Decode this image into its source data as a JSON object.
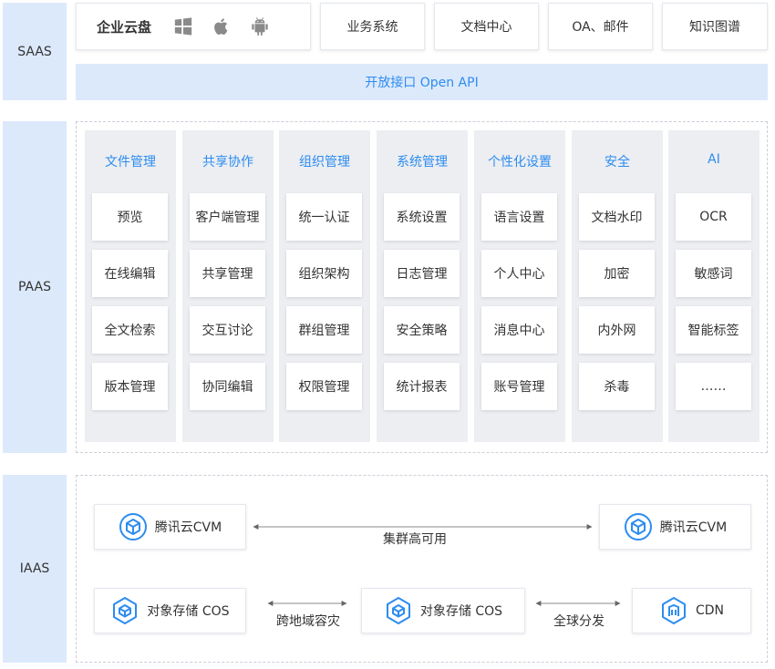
{
  "colors": {
    "accent": "#2d8cf0",
    "layer_bg": "#dce9fb",
    "column_bg": "#eceef2"
  },
  "layers": {
    "saas": "SAAS",
    "paas": "PAAS",
    "iaas": "IAAS"
  },
  "saas": {
    "cloud_disk": "企业云盘",
    "platform_icons": [
      "windows-icon",
      "apple-icon",
      "android-icon"
    ],
    "business_system": "业务系统",
    "doc_center": "文档中心",
    "oa_mail": "OA、邮件",
    "knowledge_graph": "知识图谱",
    "open_api": "开放接口 Open API"
  },
  "paas": {
    "columns": [
      {
        "title": "文件管理",
        "items": [
          "预览",
          "在线编辑",
          "全文检索",
          "版本管理"
        ]
      },
      {
        "title": "共享协作",
        "items": [
          "客户端管理",
          "共享管理",
          "交互讨论",
          "协同编辑"
        ]
      },
      {
        "title": "组织管理",
        "items": [
          "统一认证",
          "组织架构",
          "群组管理",
          "权限管理"
        ]
      },
      {
        "title": "系统管理",
        "items": [
          "系统设置",
          "日志管理",
          "安全策略",
          "统计报表"
        ]
      },
      {
        "title": "个性化设置",
        "items": [
          "语言设置",
          "个人中心",
          "消息中心",
          "账号管理"
        ]
      },
      {
        "title": "安全",
        "items": [
          "文档水印",
          "加密",
          "内外网",
          "杀毒"
        ]
      },
      {
        "title": "AI",
        "items": [
          "OCR",
          "敏感词",
          "智能标签",
          "……"
        ]
      }
    ]
  },
  "iaas": {
    "cvm_left": "腾讯云CVM",
    "cvm_right": "腾讯云CVM",
    "ha_label": "集群高可用",
    "cos_left": "对象存储 COS",
    "cos_mid": "对象存储 COS",
    "cdn": "CDN",
    "cross_region": "跨地域容灾",
    "global_dist": "全球分发"
  }
}
